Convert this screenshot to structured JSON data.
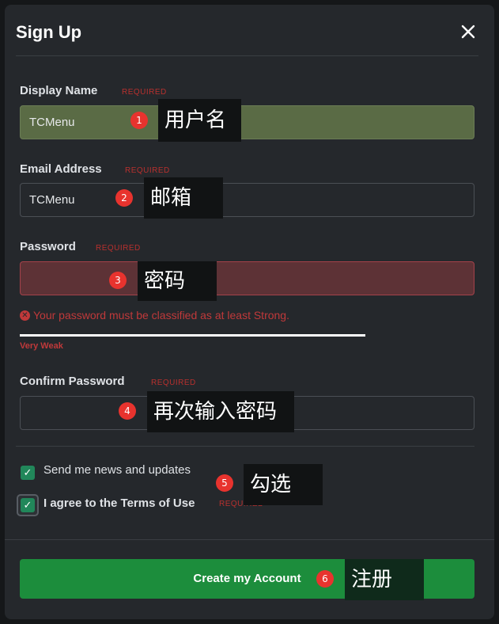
{
  "dialog": {
    "title": "Sign Up",
    "close_icon": "close-icon"
  },
  "fields": {
    "display_name": {
      "label": "Display Name",
      "required": "REQUIRED",
      "value": "TCMenu"
    },
    "email": {
      "label": "Email Address",
      "required": "REQUIRED",
      "value": "TCMenu"
    },
    "password": {
      "label": "Password",
      "required": "REQUIRED",
      "value": "",
      "error": "Your password must be classified as at least Strong.",
      "strength": "Very Weak"
    },
    "confirm_password": {
      "label": "Confirm Password",
      "required": "REQUIRED",
      "value": ""
    }
  },
  "checkboxes": {
    "news": {
      "label": "Send me news and updates",
      "checked": true
    },
    "terms": {
      "prefix": "I agree to the ",
      "link": "Terms of Use",
      "required": "REQUIRED",
      "checked": true
    }
  },
  "submit": {
    "label": "Create my Account"
  },
  "annotations": [
    {
      "num": "1",
      "text": "用户名"
    },
    {
      "num": "2",
      "text": "邮箱"
    },
    {
      "num": "3",
      "text": "密码"
    },
    {
      "num": "4",
      "text": "再次输入密码"
    },
    {
      "num": "5",
      "text": "勾选"
    },
    {
      "num": "6",
      "text": "注册"
    }
  ],
  "colors": {
    "accent_green": "#1c8d3c",
    "error_red": "#c0393a",
    "checkbox_green": "#21875a",
    "annotation_badge": "#e8332e"
  }
}
